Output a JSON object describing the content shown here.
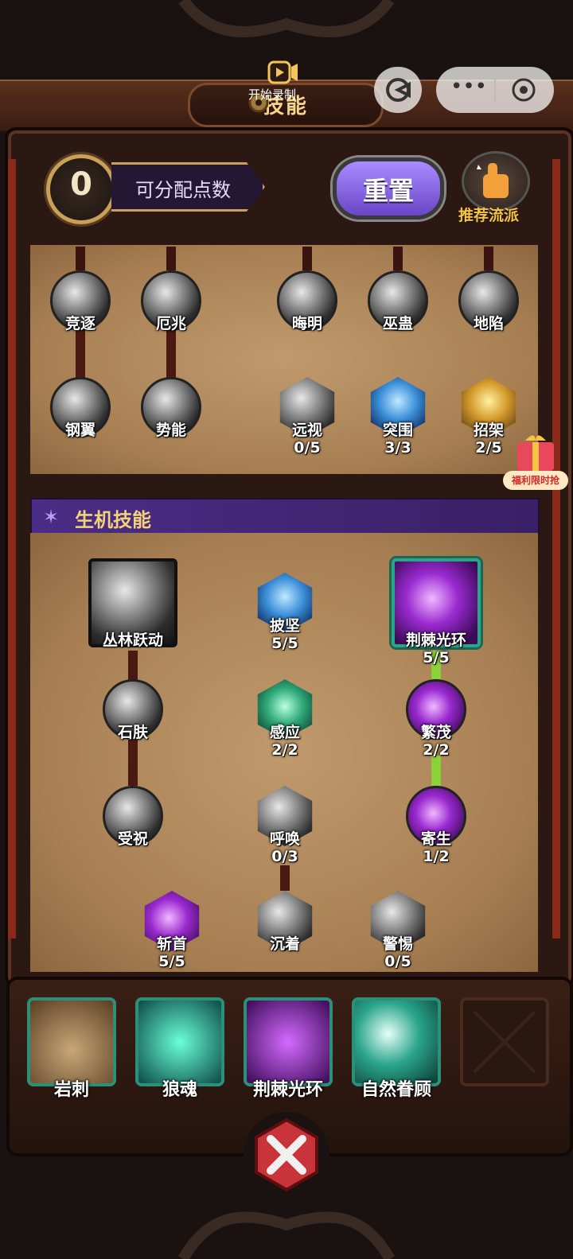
{
  "header": {
    "title": "技能",
    "record_label": "开始录制"
  },
  "points": {
    "value": "0",
    "label": "可分配点数"
  },
  "toolbar": {
    "reset_label": "重置",
    "recommend_label": "推荐流派"
  },
  "upper_tree": {
    "row1": [
      {
        "name": "竞逐"
      },
      {
        "name": "厄兆"
      },
      {
        "name": "晦明"
      },
      {
        "name": "巫蛊"
      },
      {
        "name": "地陷"
      }
    ],
    "row2": [
      {
        "name": "钢翼"
      },
      {
        "name": "势能"
      },
      {
        "name": "远视",
        "level": "0/5"
      },
      {
        "name": "突围",
        "level": "3/3"
      },
      {
        "name": "招架",
        "level": "2/5"
      }
    ]
  },
  "section": {
    "title": "生机技能"
  },
  "vitality_tree": {
    "jungle": {
      "name": "丛林跃动"
    },
    "pishi": {
      "name": "披坚",
      "level": "5/5"
    },
    "thorn": {
      "name": "荆棘光环",
      "level": "5/5"
    },
    "stone": {
      "name": "石肤"
    },
    "sense": {
      "name": "感应",
      "level": "2/2"
    },
    "lush": {
      "name": "繁茂",
      "level": "2/2"
    },
    "blessed": {
      "name": "受祝"
    },
    "summon": {
      "name": "呼唤",
      "level": "0/3"
    },
    "parasite": {
      "name": "寄生",
      "level": "1/2"
    },
    "behead": {
      "name": "斩首",
      "level": "5/5"
    },
    "calm": {
      "name": "沉着"
    },
    "alert": {
      "name": "警惕",
      "level": "0/5"
    }
  },
  "bottom_slots": [
    {
      "label": "岩刺"
    },
    {
      "label": "狼魂"
    },
    {
      "label": "荆棘光环"
    },
    {
      "label": "自然眷顾"
    }
  ],
  "promo": {
    "label": "福利限时抢"
  },
  "colors": {
    "accent_gold": "#f3d27a",
    "section_purple": "#4b2c86",
    "active_link": "#8bd23a",
    "reset_purple": "#8a6ae0"
  }
}
